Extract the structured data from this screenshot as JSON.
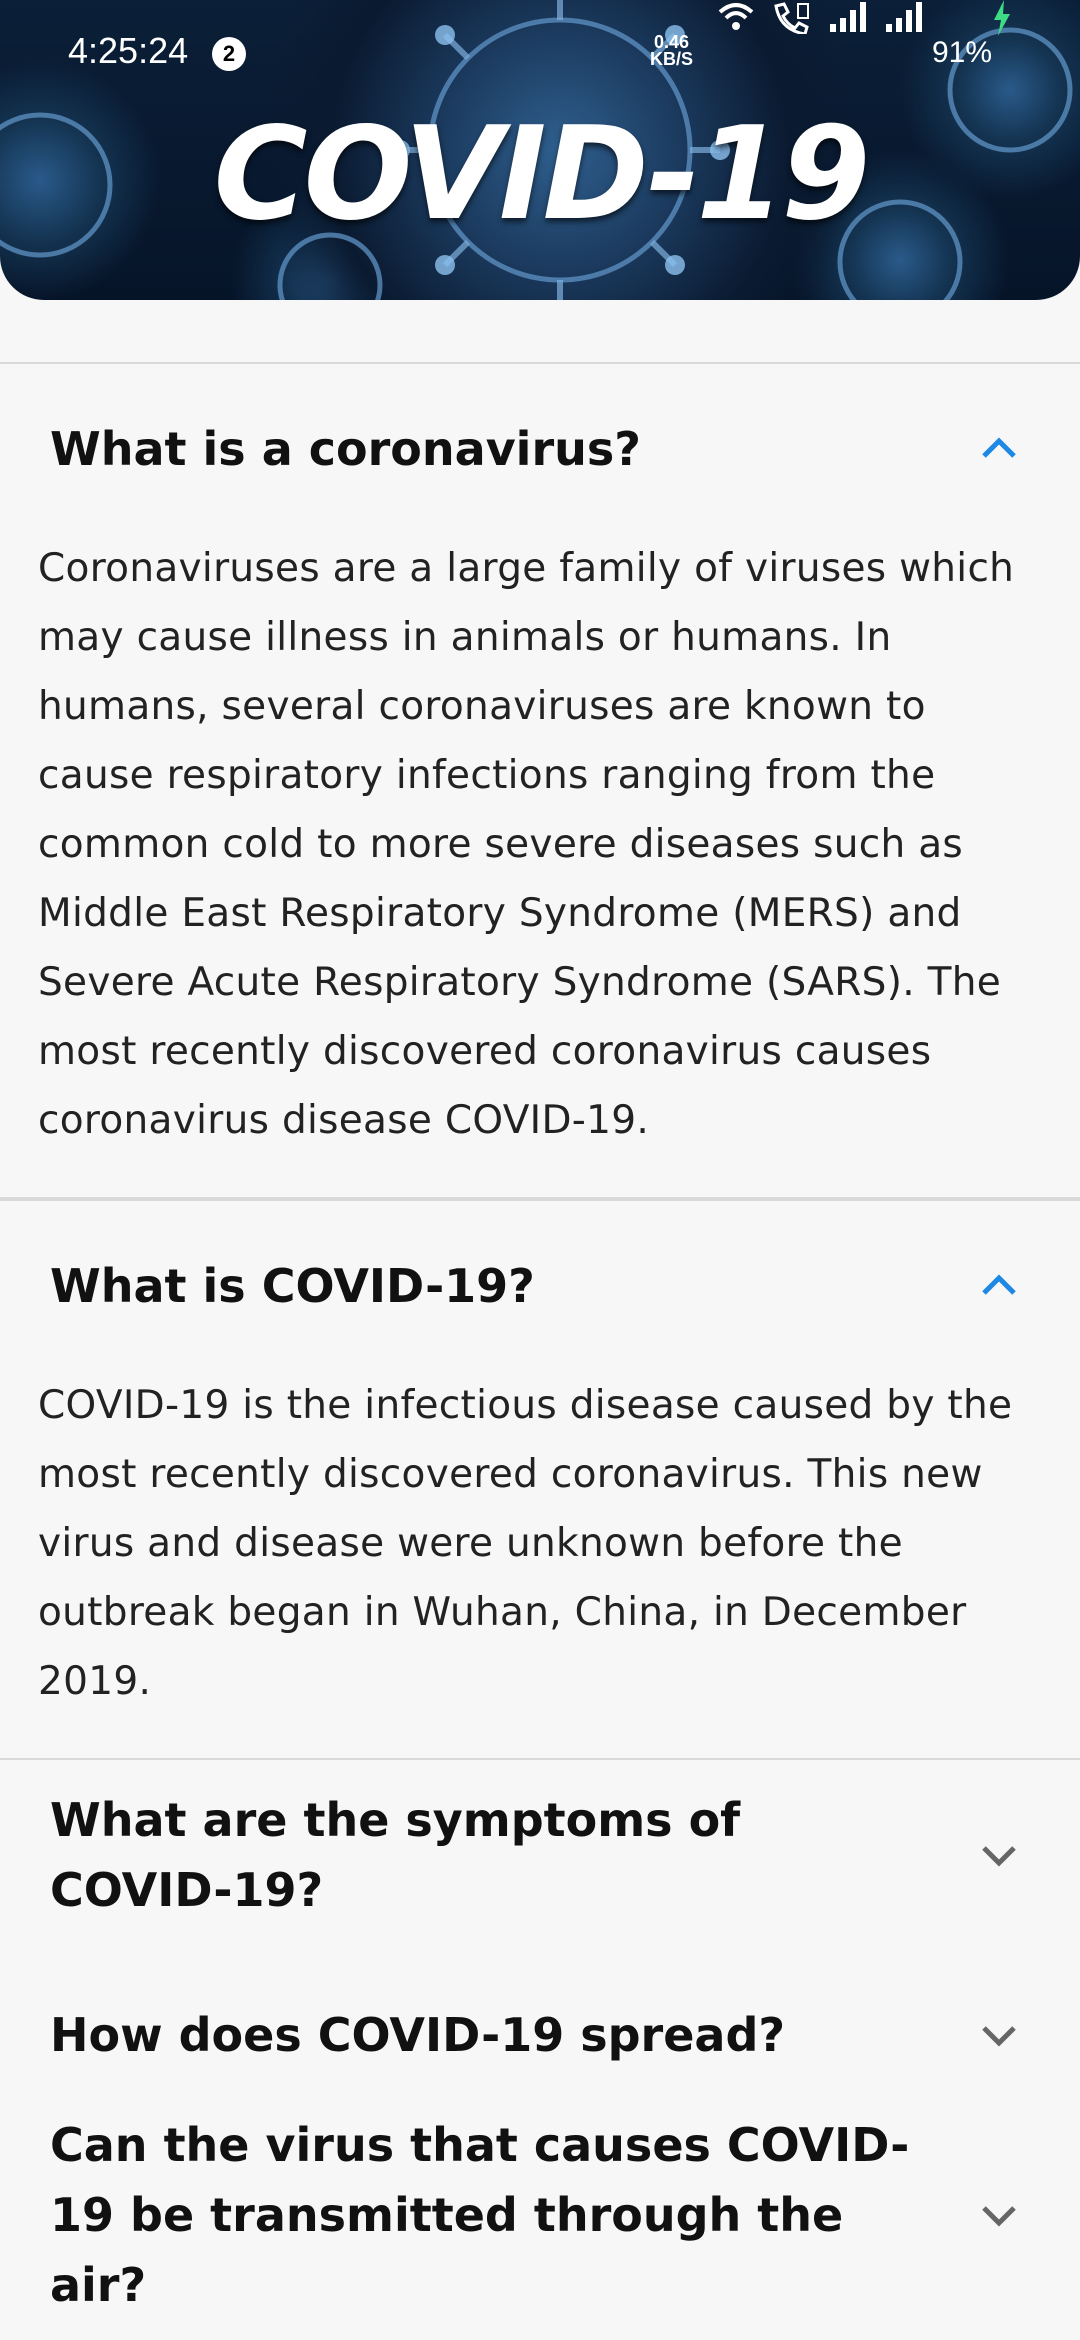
{
  "status_bar": {
    "time": "4:25:24",
    "notification_count": "2",
    "net_speed_value": "0.46",
    "net_speed_unit": "KB/S",
    "battery": "91%"
  },
  "banner": {
    "title": "COVID-19"
  },
  "colors": {
    "accent": "#1e88e5",
    "battery_charge": "#3ddc84"
  },
  "faq": [
    {
      "question": "What is a coronavirus?",
      "expanded": true,
      "answer": "Coronaviruses are a large family of viruses which may cause illness in animals or humans.  In humans, several coronaviruses are known to cause respiratory infections ranging from the common cold to more severe diseases such as Middle East Respiratory Syndrome (MERS) and Severe Acute Respiratory Syndrome (SARS). The most recently discovered coronavirus causes coronavirus disease COVID-19."
    },
    {
      "question": "What is COVID-19?",
      "expanded": true,
      "answer": "COVID-19 is the infectious disease caused by the most recently discovered coronavirus. This new virus and disease were unknown before the outbreak began in Wuhan, China, in December 2019."
    },
    {
      "question": "What are the symptoms of COVID-19?",
      "expanded": false
    },
    {
      "question": "How does COVID-19 spread?",
      "expanded": false
    },
    {
      "question": "Can the virus that causes COVID-19 be transmitted through the air?",
      "expanded": false
    }
  ]
}
